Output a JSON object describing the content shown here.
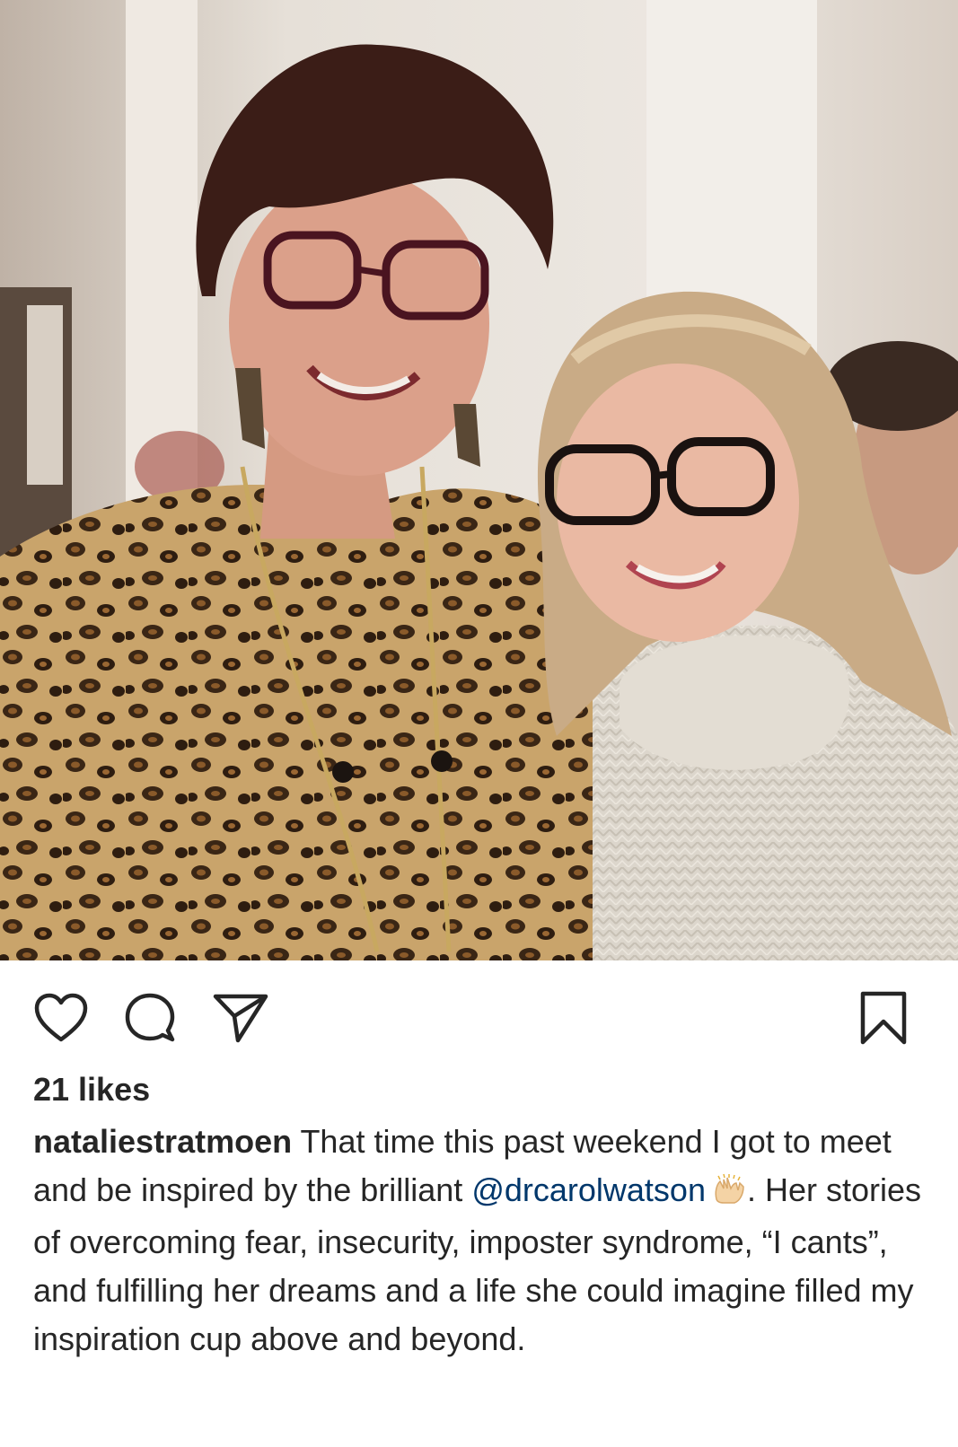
{
  "post": {
    "likes_text": "21 likes",
    "username": "nataliestratmoen",
    "caption_part1": " That time this past weekend I got to meet and be inspired by the brilliant ",
    "mention": "@drcarolwatson",
    "emoji_name": "raising-hands-emoji",
    "caption_part2": ". Her stories of overcoming fear, insecurity, imposter syndrome, “I cants”, and fulfilling her dreams and a life she could imagine filled my inspiration cup above and beyond."
  },
  "actions": {
    "like_icon": "heart-icon",
    "comment_icon": "comment-icon",
    "share_icon": "paper-plane-icon",
    "save_icon": "bookmark-icon"
  },
  "colors": {
    "text": "#262626",
    "mention": "#00376b",
    "background": "#ffffff"
  }
}
